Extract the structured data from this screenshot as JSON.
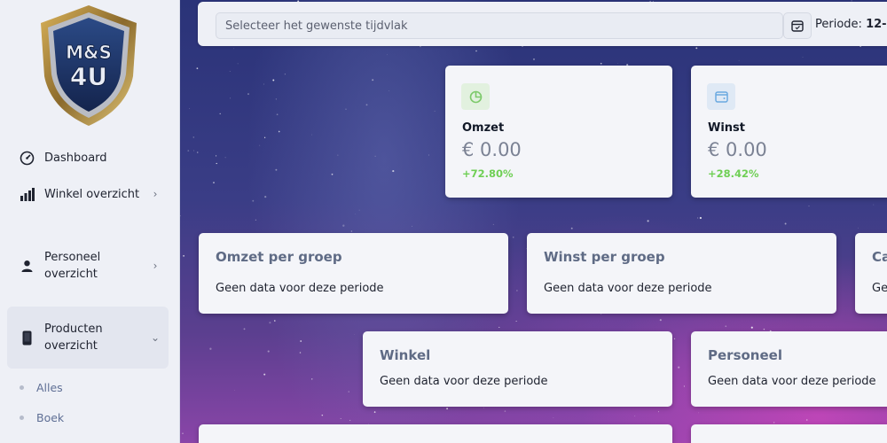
{
  "sidebar": {
    "logo_text_top": "M&S",
    "logo_text_bottom": "4U",
    "items": [
      {
        "label": "Dashboard",
        "icon": "gauge-icon"
      },
      {
        "label": "Winkel overzicht",
        "icon": "bar-chart-icon"
      },
      {
        "label": "Personeel overzicht",
        "icon": "user-icon"
      },
      {
        "label": "Producten overzicht",
        "icon": "phone-icon"
      }
    ],
    "sub_items": [
      {
        "label": "Alles"
      },
      {
        "label": "Boek"
      }
    ]
  },
  "topbar": {
    "date_placeholder": "Selecteer het gewenste tijdvlak",
    "periode_label": "Periode:",
    "periode_value": "12-"
  },
  "stats": [
    {
      "title": "Omzet",
      "value": "€ 0.00",
      "change": "+72.80%",
      "icon": "pie-chart-icon",
      "icon_color": "#7cc96a",
      "icon_bg": "#e2f1df"
    },
    {
      "title": "Winst",
      "value": "€ 0.00",
      "change": "+28.42%",
      "icon": "wallet-icon",
      "icon_color": "#6aa9e0",
      "icon_bg": "#dfe9f5"
    }
  ],
  "panels": {
    "omzet_per_groep": {
      "title": "Omzet per groep",
      "text": "Geen data voor deze periode"
    },
    "winst_per_groep": {
      "title": "Winst per groep",
      "text": "Geen data voor deze periode"
    },
    "partial": {
      "title": "Ca",
      "text": "Ge"
    },
    "winkel": {
      "title": "Winkel",
      "text": "Geen data voor deze periode"
    },
    "personeel": {
      "title": "Personeel",
      "text": "Geen data voor deze periode"
    }
  },
  "colors": {
    "positive": "#6fcf55",
    "sidebar_bg": "#eef0f6",
    "panel_title": "#5f6b85"
  }
}
